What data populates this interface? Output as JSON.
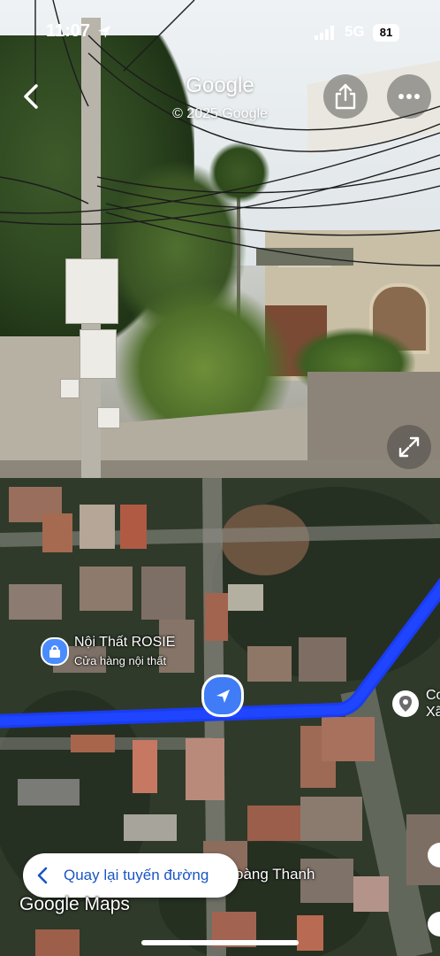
{
  "status_bar": {
    "time": "11:07",
    "network": "5G",
    "battery": "81"
  },
  "street_view": {
    "title": "Google",
    "copyright": "© 2025 Google",
    "icons": [
      "back-icon",
      "share-icon",
      "more-icon",
      "expand-icon"
    ]
  },
  "map": {
    "poi": {
      "name": "Nội Thất ROSIE",
      "category": "Cửa hàng nội thất"
    },
    "poi_right_partial": [
      "Co",
      "Xã"
    ],
    "street_label": "oàng Thanh",
    "return_button": "Quay lại tuyến đường",
    "logo": "Google Maps",
    "route_color": "#1a3cf0",
    "accent_color": "#3f7cf5"
  }
}
